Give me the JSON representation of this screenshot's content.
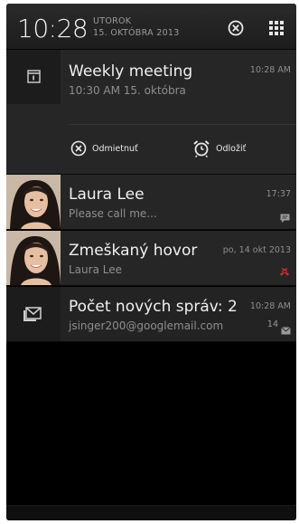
{
  "statusbar": {
    "time": "10:28",
    "weekday": "UTOROK",
    "date": "15. OKTÓBRA 2013"
  },
  "notifications": [
    {
      "title": "Weekly meeting",
      "subtitle": "10:30 AM 15. októbra",
      "time": "10:28 AM",
      "icon": "calendar-icon",
      "actions": [
        {
          "label": "Odmietnuť",
          "icon": "dismiss-icon"
        },
        {
          "label": "Odložiť",
          "icon": "alarm-snooze-icon"
        }
      ]
    },
    {
      "title": "Laura Lee",
      "subtitle": "Please call me...",
      "time": "17:37",
      "icon": "message-icon"
    },
    {
      "title": "Zmeškaný hovor",
      "subtitle": "Laura Lee",
      "time": "po, 14 okt 2013",
      "icon": "missed-call-icon"
    },
    {
      "title": "Počet nových správ: 2",
      "subtitle": "jsinger200@googlemail.com",
      "time": "10:28 AM",
      "count": "14",
      "icon": "mail-icon"
    }
  ],
  "colors": {
    "background": "#000000",
    "card": "#262626",
    "title_text": "#f0f0f0",
    "secondary_text": "#8e8e8e",
    "missed_call": "#d8332c"
  }
}
